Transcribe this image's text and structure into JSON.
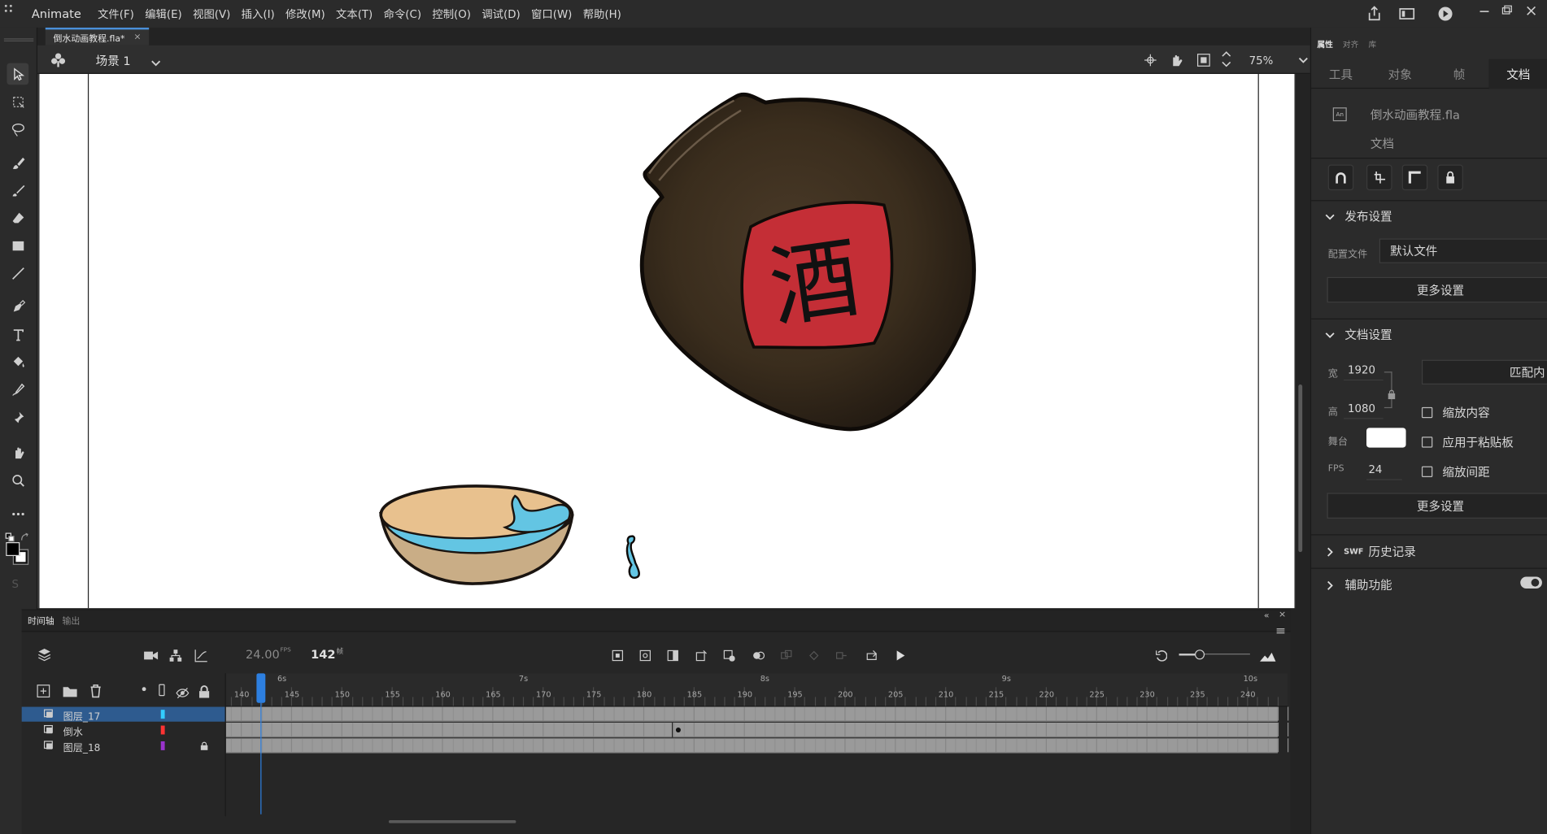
{
  "app": {
    "name": "Animate"
  },
  "menu": [
    "文件(F)",
    "编辑(E)",
    "视图(V)",
    "插入(I)",
    "修改(M)",
    "文本(T)",
    "命令(C)",
    "控制(O)",
    "调试(D)",
    "窗口(W)",
    "帮助(H)"
  ],
  "document_tab": {
    "title": "倒水动画教程.fla*",
    "close": "×"
  },
  "editbar": {
    "scene": "场景 1",
    "zoom": "75%"
  },
  "stage": {
    "jar_label": "酒",
    "background": "#ffffff"
  },
  "panel": {
    "tabs_small": [
      "属性",
      "对齐",
      "库"
    ],
    "tabs": [
      "工具",
      "对象",
      "帧",
      "文档"
    ],
    "active_tab": "文档",
    "doc_file": "倒水动画教程.fla",
    "doc_type": "文档",
    "publish": {
      "title": "发布设置",
      "profile_label": "配置文件",
      "profile_value": "默认文件",
      "more": "更多设置"
    },
    "docsettings": {
      "title": "文档设置",
      "width_label": "宽",
      "width": "1920",
      "height_label": "高",
      "height": "1080",
      "match_button": "匹配内",
      "stage_label": "舞台",
      "stage_color": "#ffffff",
      "fps_label": "FPS",
      "fps": "24",
      "scale_content": "缩放内容",
      "apply_pasteboard": "应用于粘贴板",
      "scale_spacing": "缩放间距",
      "more": "更多设置"
    },
    "swf_history": {
      "badge": "SWF",
      "title": "历史记录"
    },
    "accessibility": {
      "title": "辅助功能"
    }
  },
  "timeline": {
    "tabs": [
      "时间轴",
      "输出"
    ],
    "fps": "24.00",
    "fps_unit": "FPS",
    "frame": "142",
    "frame_unit": "帧",
    "seconds": [
      {
        "label": "6s",
        "frame": 144
      },
      {
        "label": "7s",
        "frame": 168
      },
      {
        "label": "8s",
        "frame": 192
      },
      {
        "label": "9s",
        "frame": 216
      },
      {
        "label": "10s",
        "frame": 240
      }
    ],
    "frame_labels": [
      140,
      145,
      150,
      155,
      160,
      165,
      170,
      175,
      180,
      185,
      190,
      195,
      200,
      205,
      210,
      215,
      220,
      225,
      230,
      235,
      240
    ],
    "first_frame": 138.5,
    "last_frame": 244,
    "playhead_frame": 142,
    "layers": [
      {
        "name": "图层_17",
        "color": "#33ccff",
        "selected": true,
        "locked": false
      },
      {
        "name": "倒水",
        "color": "#ff3333",
        "selected": false,
        "locked": false
      },
      {
        "name": "图层_18",
        "color": "#9933cc",
        "selected": false,
        "locked": true
      }
    ],
    "keyframe_frame": 183
  }
}
